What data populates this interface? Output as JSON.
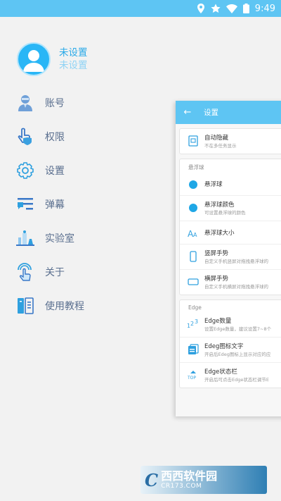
{
  "status_bar": {
    "time": "9:49",
    "icons": [
      "location-icon",
      "star-icon",
      "wifi-icon",
      "battery-icon"
    ]
  },
  "profile": {
    "name": "未设置",
    "subtitle": "未设置"
  },
  "menu": {
    "items": [
      {
        "label": "账号",
        "icon": "account-icon"
      },
      {
        "label": "权限",
        "icon": "permission-icon"
      },
      {
        "label": "设置",
        "icon": "settings-gear-icon"
      },
      {
        "label": "弹幕",
        "icon": "danmaku-icon"
      },
      {
        "label": "实验室",
        "icon": "lab-icon"
      },
      {
        "label": "关于",
        "icon": "about-touch-icon"
      },
      {
        "label": "使用教程",
        "icon": "tutorial-book-icon"
      }
    ]
  },
  "preview": {
    "back": "←",
    "title": "设置",
    "auto_hide": {
      "title": "自动隐藏",
      "sub": "不在多任务显示"
    },
    "section_float": "悬浮球",
    "float_ball": {
      "title": "悬浮球"
    },
    "float_color": {
      "title": "悬浮球颜色",
      "sub": "可设置悬浮球的颜色"
    },
    "float_size": {
      "title": "悬浮球大小"
    },
    "portrait_gesture": {
      "title": "竖屏手势",
      "sub": "自定义手机竖屏对拖拽悬浮球的"
    },
    "landscape_gesture": {
      "title": "横屏手势",
      "sub": "自定义手机横屏对拖拽悬浮球的"
    },
    "section_edge": "Edge",
    "edge_count": {
      "title": "Edge数量",
      "sub": "设置Edge数量，建议设置7~8个"
    },
    "edge_icon_text": {
      "title": "Edeg图标文字",
      "sub": "开启后Edeg图标上显示对应的应"
    },
    "edge_statusbar": {
      "title": "Edge状态栏",
      "sub": "开启后可点击Edge状态栏调节E"
    }
  },
  "watermark": {
    "cn": "西西软件园",
    "url": "CR173.COM"
  },
  "colors": {
    "accent": "#5ec5f3",
    "accent_dark": "#29a9e8",
    "menu_text": "#5a6f8f",
    "drawer_bg": "#f2f2f2"
  }
}
